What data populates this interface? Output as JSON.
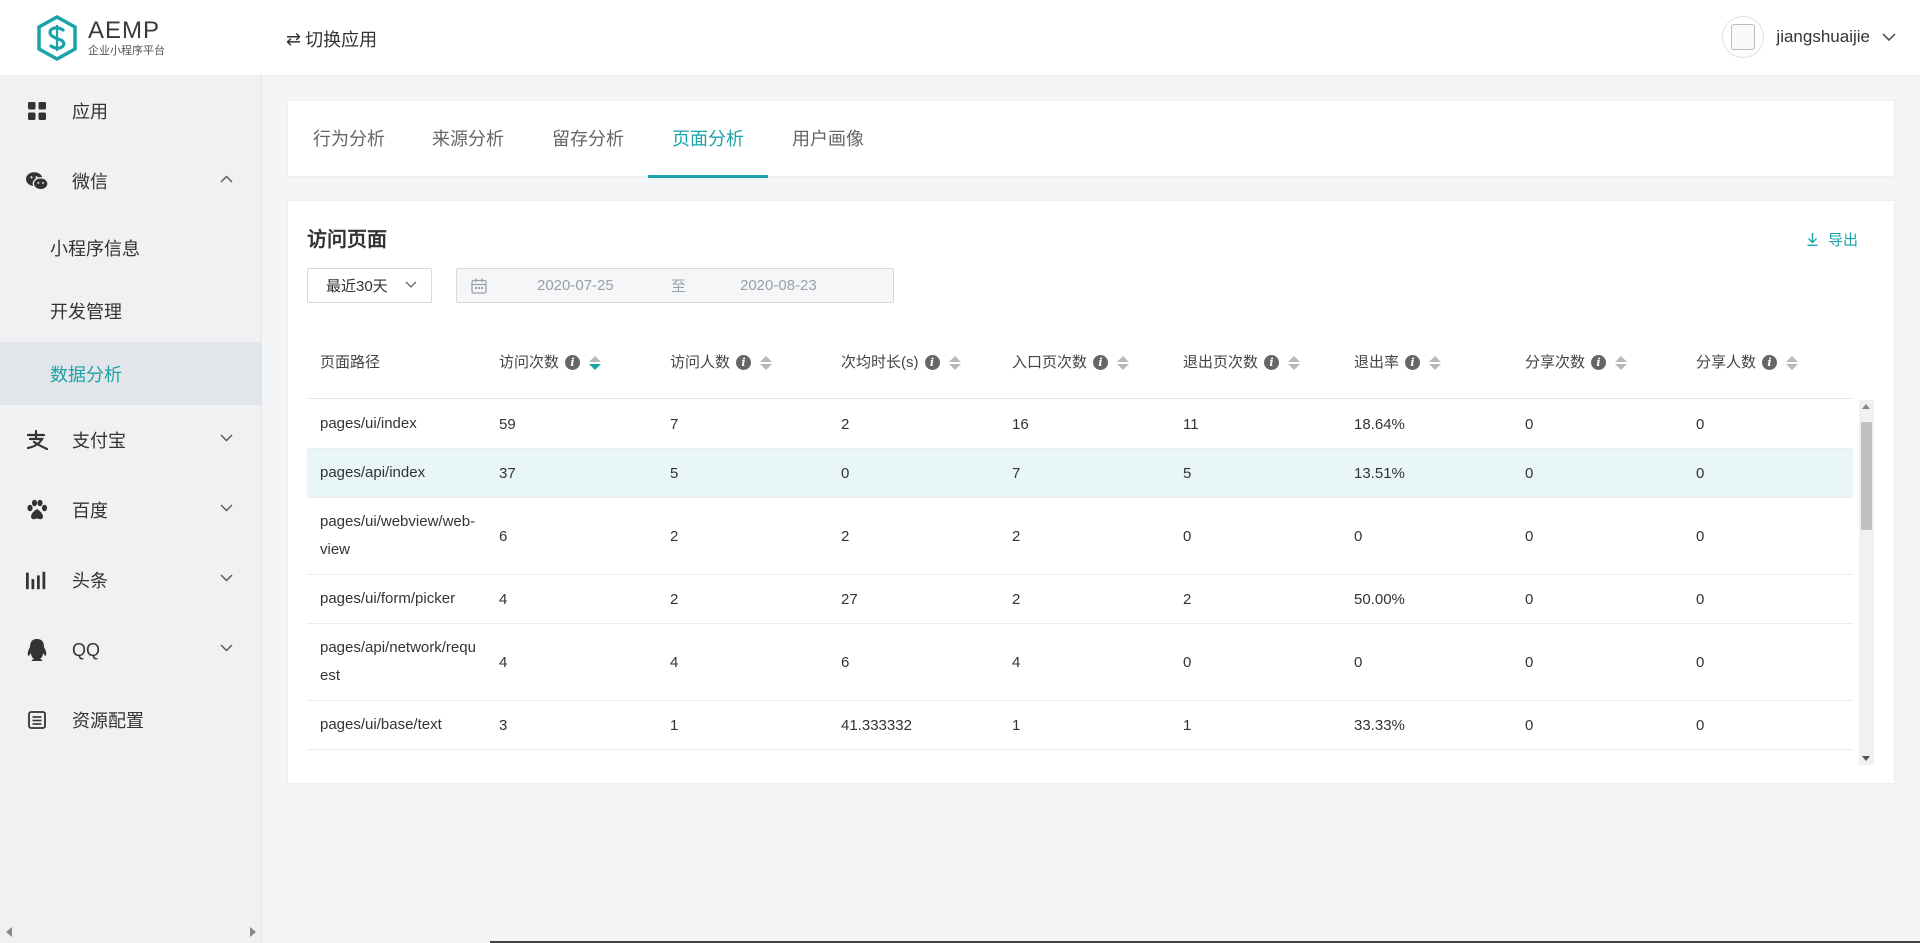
{
  "header": {
    "logo_title": "AEMP",
    "logo_subtitle": "企业小程序平台",
    "switch_app_label": "切换应用",
    "username": "jiangshuaijie"
  },
  "sidebar": {
    "items": [
      {
        "label": "应用",
        "icon": "grid-icon"
      },
      {
        "label": "微信",
        "icon": "wechat-icon",
        "expanded": true
      },
      {
        "label": "支付宝",
        "icon": "alipay-icon"
      },
      {
        "label": "百度",
        "icon": "baidu-paw-icon"
      },
      {
        "label": "头条",
        "icon": "toutiao-bars-icon"
      },
      {
        "label": "QQ",
        "icon": "qq-penguin-icon"
      },
      {
        "label": "资源配置",
        "icon": "list-icon"
      }
    ],
    "wechat_sub": [
      {
        "label": "小程序信息"
      },
      {
        "label": "开发管理"
      },
      {
        "label": "数据分析",
        "active": true
      }
    ]
  },
  "tabs": [
    {
      "label": "行为分析"
    },
    {
      "label": "来源分析"
    },
    {
      "label": "留存分析"
    },
    {
      "label": "页面分析",
      "active": true
    },
    {
      "label": "用户画像"
    }
  ],
  "panel": {
    "title": "访问页面",
    "export_label": "导出",
    "range_value": "最近30天",
    "date_start": "2020-07-25",
    "date_sep": "至",
    "date_end": "2020-08-23"
  },
  "table": {
    "columns": [
      "页面路径",
      "访问次数",
      "访问人数",
      "次均时长(s)",
      "入口页次数",
      "退出页次数",
      "退出率",
      "分享次数",
      "分享人数"
    ],
    "rows": [
      [
        "pages/ui/index",
        "59",
        "7",
        "2",
        "16",
        "11",
        "18.64%",
        "0",
        "0"
      ],
      [
        "pages/api/index",
        "37",
        "5",
        "0",
        "7",
        "5",
        "13.51%",
        "0",
        "0"
      ],
      [
        "pages/ui/webview/web-view",
        "6",
        "2",
        "2",
        "2",
        "0",
        "0",
        "0",
        "0"
      ],
      [
        "pages/ui/form/picker",
        "4",
        "2",
        "27",
        "2",
        "2",
        "50.00%",
        "0",
        "0"
      ],
      [
        "pages/api/network/request",
        "4",
        "4",
        "6",
        "4",
        "0",
        "0",
        "0",
        "0"
      ],
      [
        "pages/ui/base/text",
        "3",
        "1",
        "41.333332",
        "1",
        "1",
        "33.33%",
        "0",
        "0"
      ]
    ]
  },
  "colors": {
    "accent": "#1aa3a8",
    "highlight_row": "#e8f6f6",
    "sidebar_bg": "#f0f1f3"
  }
}
